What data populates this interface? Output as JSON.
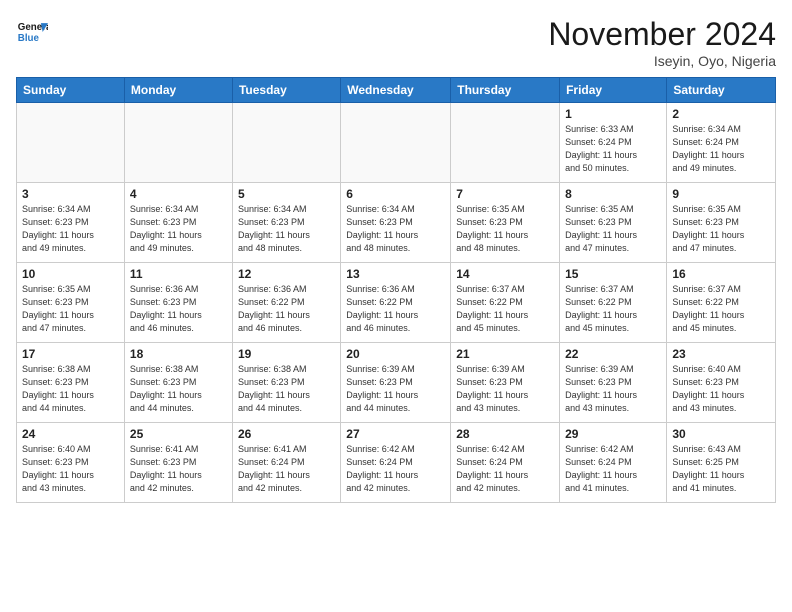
{
  "logo": {
    "line1": "General",
    "line2": "Blue"
  },
  "title": "November 2024",
  "location": "Iseyin, Oyo, Nigeria",
  "days_header": [
    "Sunday",
    "Monday",
    "Tuesday",
    "Wednesday",
    "Thursday",
    "Friday",
    "Saturday"
  ],
  "weeks": [
    [
      {
        "day": "",
        "info": ""
      },
      {
        "day": "",
        "info": ""
      },
      {
        "day": "",
        "info": ""
      },
      {
        "day": "",
        "info": ""
      },
      {
        "day": "",
        "info": ""
      },
      {
        "day": "1",
        "info": "Sunrise: 6:33 AM\nSunset: 6:24 PM\nDaylight: 11 hours\nand 50 minutes."
      },
      {
        "day": "2",
        "info": "Sunrise: 6:34 AM\nSunset: 6:24 PM\nDaylight: 11 hours\nand 49 minutes."
      }
    ],
    [
      {
        "day": "3",
        "info": "Sunrise: 6:34 AM\nSunset: 6:23 PM\nDaylight: 11 hours\nand 49 minutes."
      },
      {
        "day": "4",
        "info": "Sunrise: 6:34 AM\nSunset: 6:23 PM\nDaylight: 11 hours\nand 49 minutes."
      },
      {
        "day": "5",
        "info": "Sunrise: 6:34 AM\nSunset: 6:23 PM\nDaylight: 11 hours\nand 48 minutes."
      },
      {
        "day": "6",
        "info": "Sunrise: 6:34 AM\nSunset: 6:23 PM\nDaylight: 11 hours\nand 48 minutes."
      },
      {
        "day": "7",
        "info": "Sunrise: 6:35 AM\nSunset: 6:23 PM\nDaylight: 11 hours\nand 48 minutes."
      },
      {
        "day": "8",
        "info": "Sunrise: 6:35 AM\nSunset: 6:23 PM\nDaylight: 11 hours\nand 47 minutes."
      },
      {
        "day": "9",
        "info": "Sunrise: 6:35 AM\nSunset: 6:23 PM\nDaylight: 11 hours\nand 47 minutes."
      }
    ],
    [
      {
        "day": "10",
        "info": "Sunrise: 6:35 AM\nSunset: 6:23 PM\nDaylight: 11 hours\nand 47 minutes."
      },
      {
        "day": "11",
        "info": "Sunrise: 6:36 AM\nSunset: 6:23 PM\nDaylight: 11 hours\nand 46 minutes."
      },
      {
        "day": "12",
        "info": "Sunrise: 6:36 AM\nSunset: 6:22 PM\nDaylight: 11 hours\nand 46 minutes."
      },
      {
        "day": "13",
        "info": "Sunrise: 6:36 AM\nSunset: 6:22 PM\nDaylight: 11 hours\nand 46 minutes."
      },
      {
        "day": "14",
        "info": "Sunrise: 6:37 AM\nSunset: 6:22 PM\nDaylight: 11 hours\nand 45 minutes."
      },
      {
        "day": "15",
        "info": "Sunrise: 6:37 AM\nSunset: 6:22 PM\nDaylight: 11 hours\nand 45 minutes."
      },
      {
        "day": "16",
        "info": "Sunrise: 6:37 AM\nSunset: 6:22 PM\nDaylight: 11 hours\nand 45 minutes."
      }
    ],
    [
      {
        "day": "17",
        "info": "Sunrise: 6:38 AM\nSunset: 6:23 PM\nDaylight: 11 hours\nand 44 minutes."
      },
      {
        "day": "18",
        "info": "Sunrise: 6:38 AM\nSunset: 6:23 PM\nDaylight: 11 hours\nand 44 minutes."
      },
      {
        "day": "19",
        "info": "Sunrise: 6:38 AM\nSunset: 6:23 PM\nDaylight: 11 hours\nand 44 minutes."
      },
      {
        "day": "20",
        "info": "Sunrise: 6:39 AM\nSunset: 6:23 PM\nDaylight: 11 hours\nand 44 minutes."
      },
      {
        "day": "21",
        "info": "Sunrise: 6:39 AM\nSunset: 6:23 PM\nDaylight: 11 hours\nand 43 minutes."
      },
      {
        "day": "22",
        "info": "Sunrise: 6:39 AM\nSunset: 6:23 PM\nDaylight: 11 hours\nand 43 minutes."
      },
      {
        "day": "23",
        "info": "Sunrise: 6:40 AM\nSunset: 6:23 PM\nDaylight: 11 hours\nand 43 minutes."
      }
    ],
    [
      {
        "day": "24",
        "info": "Sunrise: 6:40 AM\nSunset: 6:23 PM\nDaylight: 11 hours\nand 43 minutes."
      },
      {
        "day": "25",
        "info": "Sunrise: 6:41 AM\nSunset: 6:23 PM\nDaylight: 11 hours\nand 42 minutes."
      },
      {
        "day": "26",
        "info": "Sunrise: 6:41 AM\nSunset: 6:24 PM\nDaylight: 11 hours\nand 42 minutes."
      },
      {
        "day": "27",
        "info": "Sunrise: 6:42 AM\nSunset: 6:24 PM\nDaylight: 11 hours\nand 42 minutes."
      },
      {
        "day": "28",
        "info": "Sunrise: 6:42 AM\nSunset: 6:24 PM\nDaylight: 11 hours\nand 42 minutes."
      },
      {
        "day": "29",
        "info": "Sunrise: 6:42 AM\nSunset: 6:24 PM\nDaylight: 11 hours\nand 41 minutes."
      },
      {
        "day": "30",
        "info": "Sunrise: 6:43 AM\nSunset: 6:25 PM\nDaylight: 11 hours\nand 41 minutes."
      }
    ]
  ]
}
